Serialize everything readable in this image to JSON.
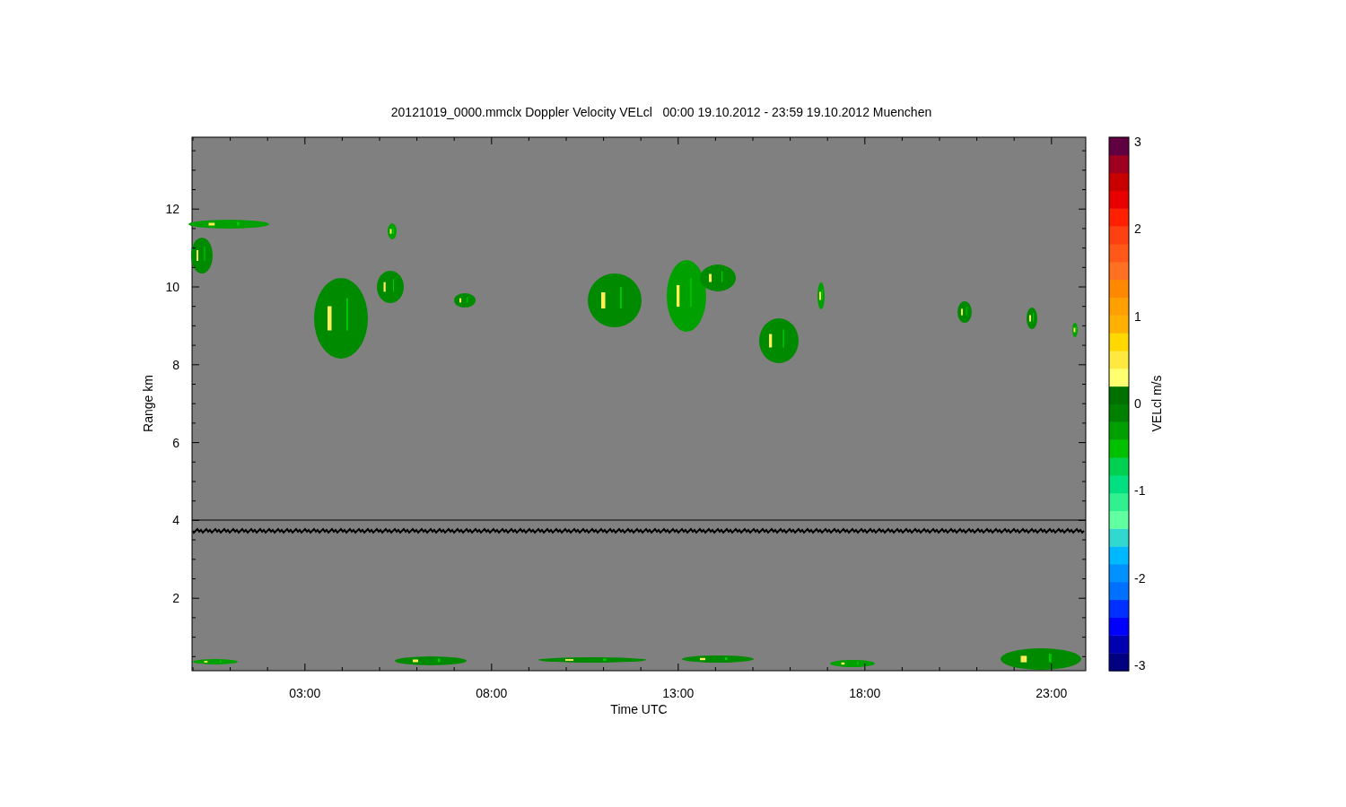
{
  "title": "20121019_0000.mmclx Doppler Velocity VELcl   00:00 19.10.2012 - 23:59 19.10.2012 Muenchen",
  "x_axis": {
    "label": "Time UTC",
    "ticks": [
      "03:00",
      "08:00",
      "13:00",
      "18:00",
      "23:00"
    ]
  },
  "y_axis": {
    "label": "Range km",
    "ticks": [
      "12",
      "10",
      "8",
      "6",
      "4",
      "2"
    ]
  },
  "colorbar": {
    "label": "VELcl m/s",
    "ticks": [
      "3",
      "2",
      "1",
      "0",
      "-1",
      "-2",
      "-3"
    ]
  }
}
